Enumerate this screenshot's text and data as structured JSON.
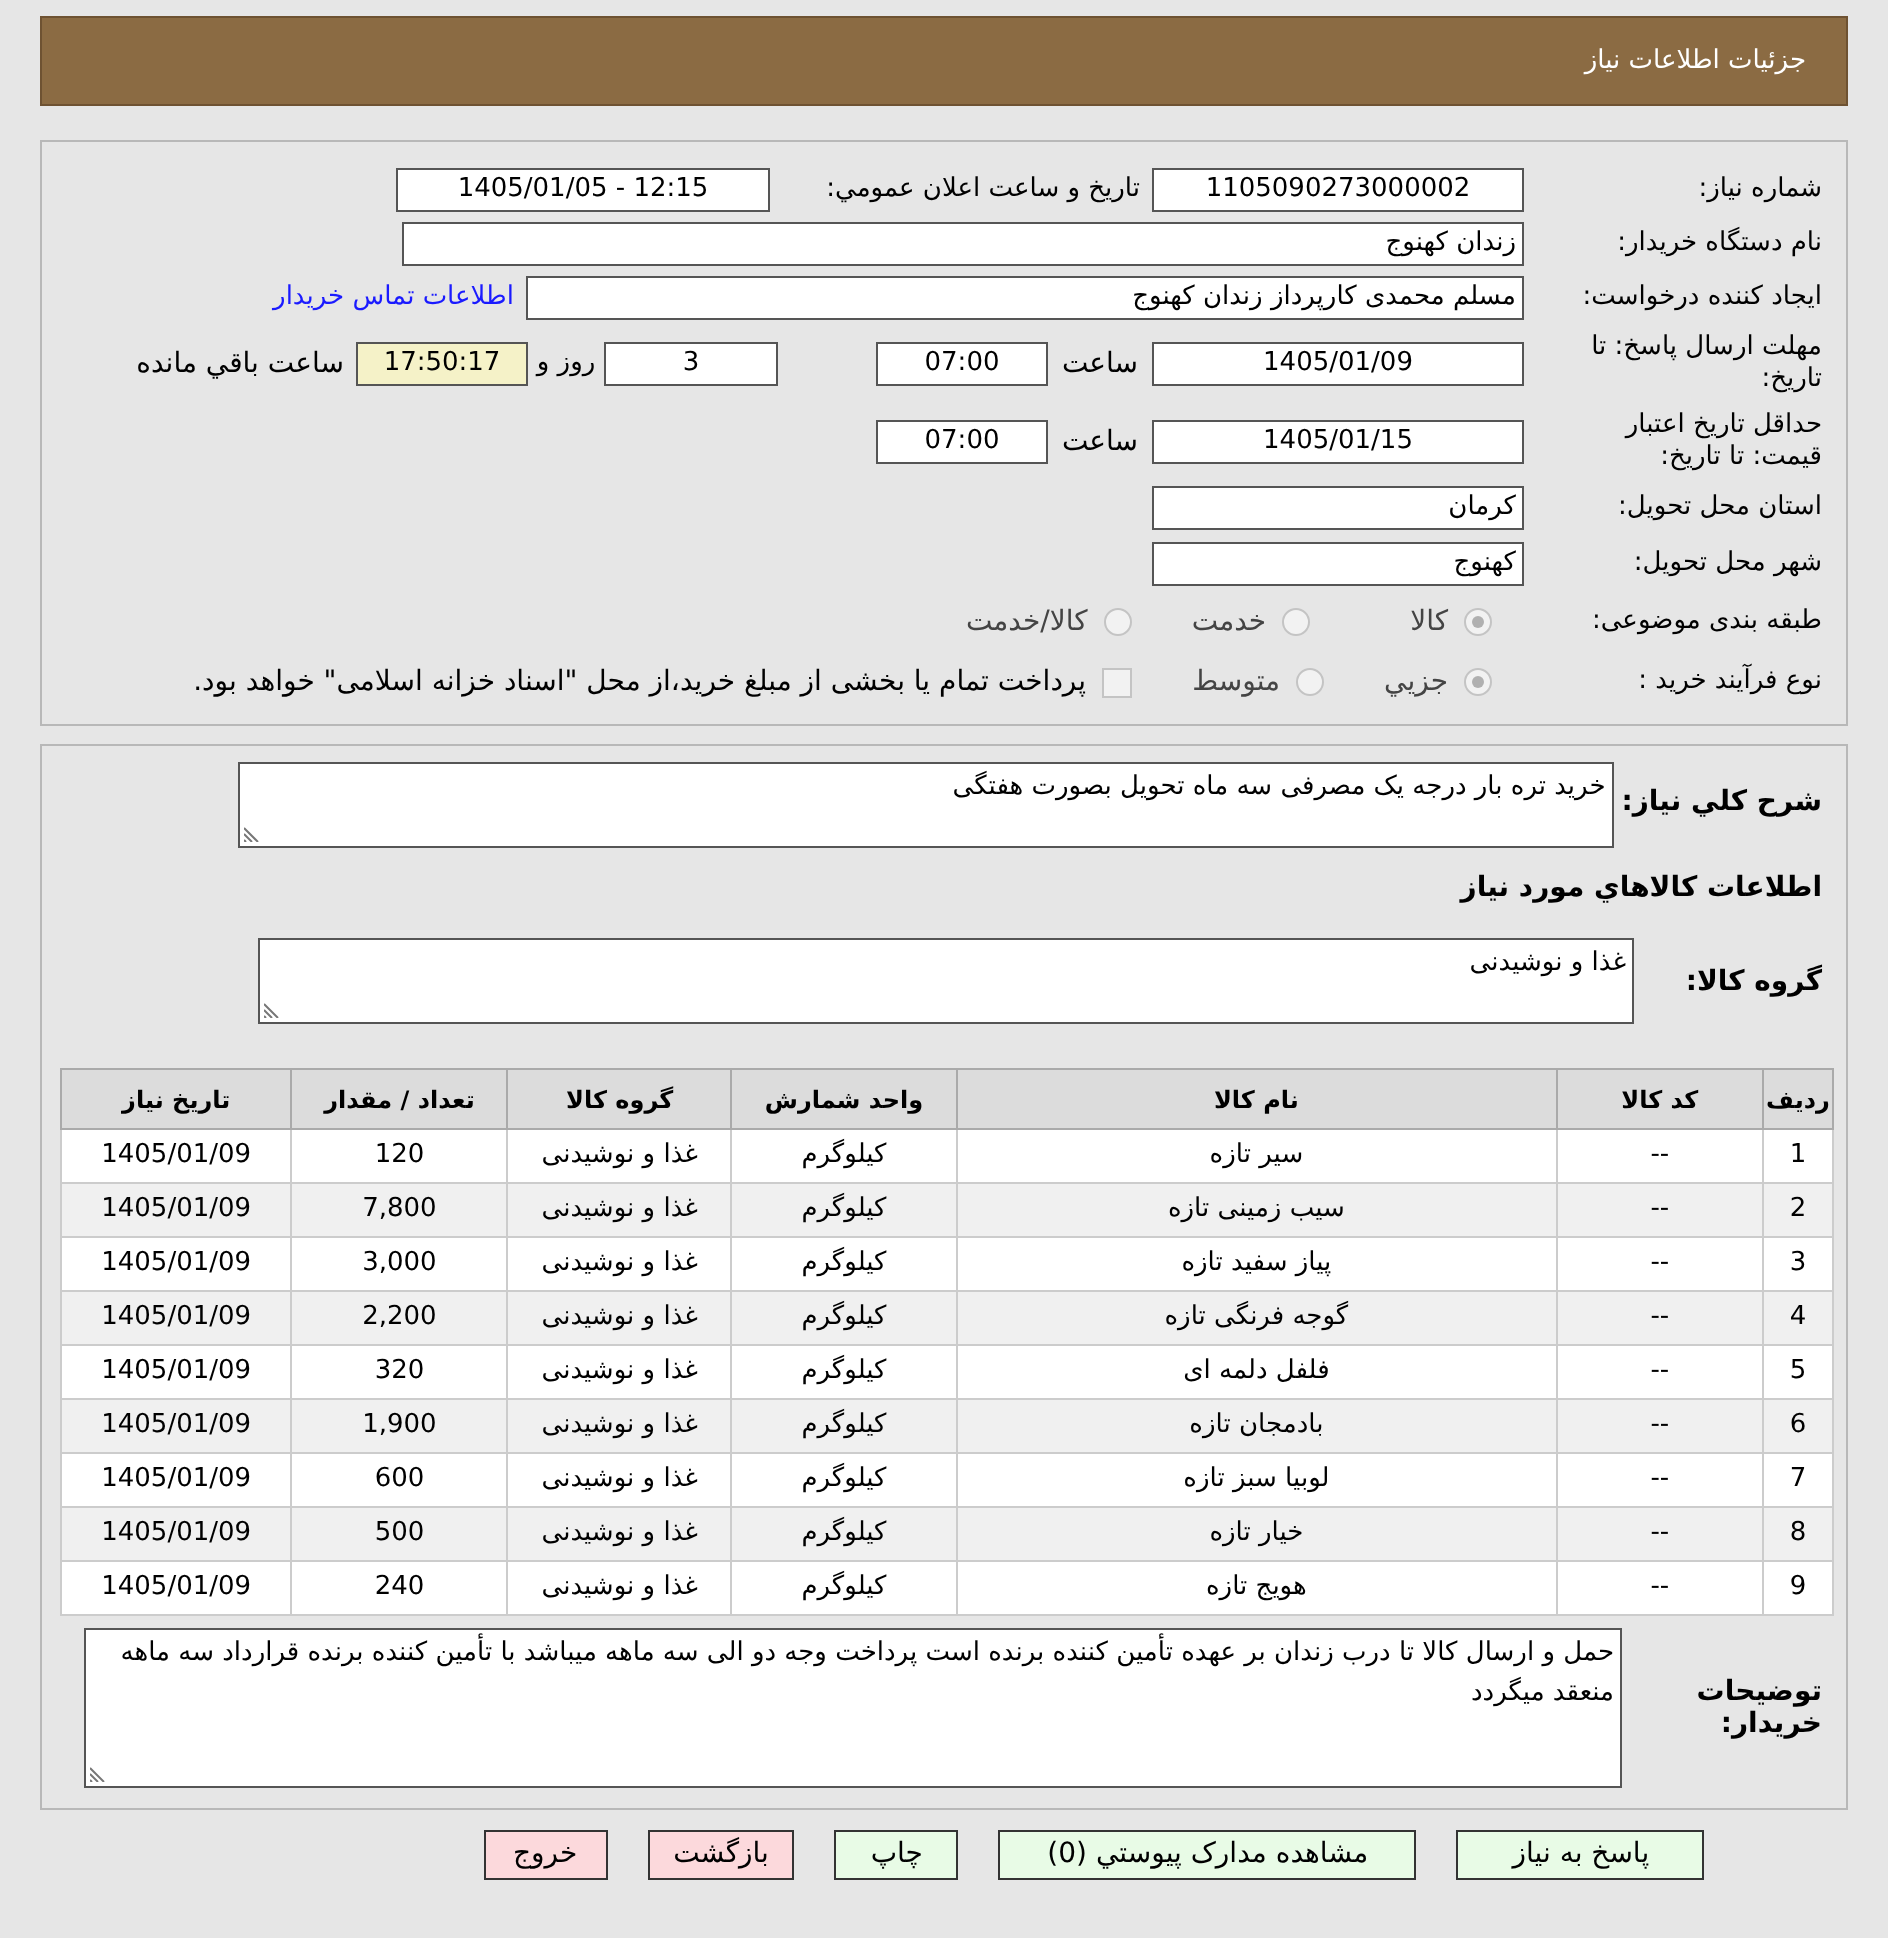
{
  "header": {
    "title": "جزئیات اطلاعات نیاز"
  },
  "need_number": {
    "label": "شماره نیاز:",
    "value": "1105090273000002"
  },
  "announce": {
    "label": "تاریخ و ساعت اعلان عمومي:",
    "value": "1405/01/05 - 12:15"
  },
  "buyer": {
    "label": "نام دستگاه خریدار:",
    "value": "زندان کهنوج"
  },
  "creator": {
    "label": "ایجاد کننده درخواست:",
    "value": "مسلم محمدی کارپرداز زندان کهنوج",
    "link": "اطلاعات تماس خریدار"
  },
  "deadline": {
    "label": "مهلت ارسال پاسخ: تا تاریخ:",
    "date": "1405/01/09",
    "time_label": "ساعت",
    "time": "07:00",
    "days": "3",
    "days_label": "روز و",
    "remaining": "17:50:17",
    "remaining_label": "ساعت باقي مانده"
  },
  "validity": {
    "label": "حداقل تاریخ اعتبار قیمت: تا تاریخ:",
    "date": "1405/01/15",
    "time_label": "ساعت",
    "time": "07:00"
  },
  "province": {
    "label": "استان محل تحویل:",
    "value": "کرمان"
  },
  "city": {
    "label": "شهر محل تحویل:",
    "value": "کهنوج"
  },
  "category": {
    "label": "طبقه بندی موضوعی:",
    "options": [
      {
        "label": "کالا",
        "selected": true
      },
      {
        "label": "خدمت",
        "selected": false
      },
      {
        "label": "کالا/خدمت",
        "selected": false
      }
    ]
  },
  "process": {
    "label": "نوع فرآیند خرید :",
    "options": [
      {
        "label": "جزيي",
        "selected": true
      },
      {
        "label": "متوسط",
        "selected": false
      }
    ],
    "treasury": {
      "checked": false,
      "label": "پرداخت تمام یا بخشی از مبلغ خرید،از محل \"اسناد خزانه اسلامی\" خواهد بود."
    }
  },
  "summary": {
    "label": "شرح کلي نیاز:",
    "value": "خرید تره بار درجه یک مصرفی سه ماه تحویل بصورت هفتگی"
  },
  "goods_heading": "اطلاعات کالاهاي مورد نیاز",
  "goods_group": {
    "label": "گروه کالا:",
    "value": "غذا و نوشیدنی"
  },
  "table": {
    "columns": [
      "ردیف",
      "کد کالا",
      "نام کالا",
      "واحد شمارش",
      "گروه کالا",
      "تعداد / مقدار",
      "تاریخ نیاز"
    ],
    "rows": [
      [
        "1",
        "--",
        "سیر تازه",
        "کیلوگرم",
        "غذا و نوشیدنی",
        "120",
        "1405/01/09"
      ],
      [
        "2",
        "--",
        "سیب زمینی تازه",
        "کیلوگرم",
        "غذا و نوشیدنی",
        "7,800",
        "1405/01/09"
      ],
      [
        "3",
        "--",
        "پیاز سفید تازه",
        "کیلوگرم",
        "غذا و نوشیدنی",
        "3,000",
        "1405/01/09"
      ],
      [
        "4",
        "--",
        "گوجه فرنگی تازه",
        "کیلوگرم",
        "غذا و نوشیدنی",
        "2,200",
        "1405/01/09"
      ],
      [
        "5",
        "--",
        "فلفل دلمه ای",
        "کیلوگرم",
        "غذا و نوشیدنی",
        "320",
        "1405/01/09"
      ],
      [
        "6",
        "--",
        "بادمجان تازه",
        "کیلوگرم",
        "غذا و نوشیدنی",
        "1,900",
        "1405/01/09"
      ],
      [
        "7",
        "--",
        "لوبیا سبز تازه",
        "کیلوگرم",
        "غذا و نوشیدنی",
        "600",
        "1405/01/09"
      ],
      [
        "8",
        "--",
        "خیار تازه",
        "کیلوگرم",
        "غذا و نوشیدنی",
        "500",
        "1405/01/09"
      ],
      [
        "9",
        "--",
        "هویج تازه",
        "کیلوگرم",
        "غذا و نوشیدنی",
        "240",
        "1405/01/09"
      ]
    ]
  },
  "comments": {
    "label": "توضیحات خریدار:",
    "value": "حمل و ارسال کالا تا درب زندان بر عهده تأمین کننده برنده است پرداخت وجه دو الی سه ماهه میباشد با تأمین کننده برنده قرارداد سه ماهه منعقد میگردد"
  },
  "buttons": [
    {
      "label": "پاسخ به نیاز",
      "kind": "action"
    },
    {
      "label": "مشاهده مدارک پیوستي (0)",
      "kind": "action"
    },
    {
      "label": "چاپ",
      "kind": "action"
    },
    {
      "label": "بازگشت",
      "kind": "danger"
    },
    {
      "label": "خروج",
      "kind": "danger"
    }
  ]
}
